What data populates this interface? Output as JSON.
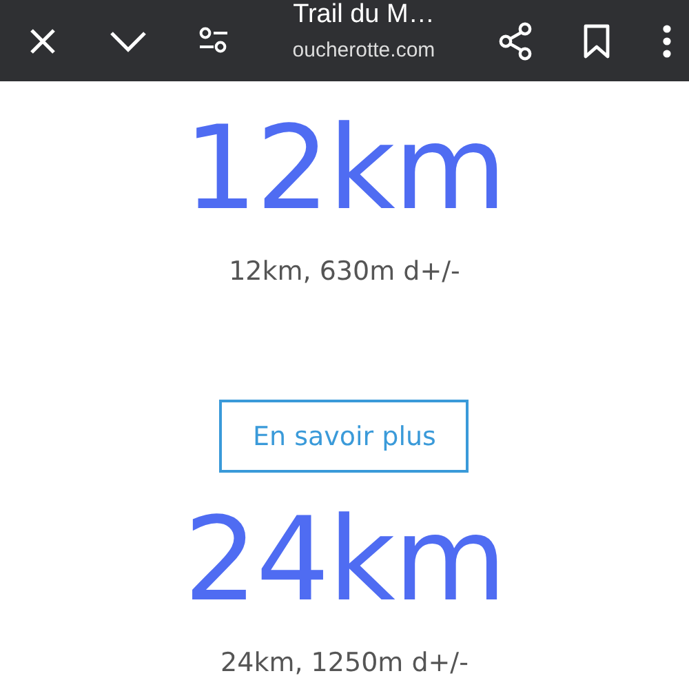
{
  "toolbar": {
    "title": "Trail du M…",
    "domain": "oucherotte.com"
  },
  "sections": [
    {
      "distance": "12km",
      "details": "12km, 630m d+/-",
      "button": "En savoir plus"
    },
    {
      "distance": "24km",
      "details": "24km, 1250m d+/-"
    }
  ]
}
